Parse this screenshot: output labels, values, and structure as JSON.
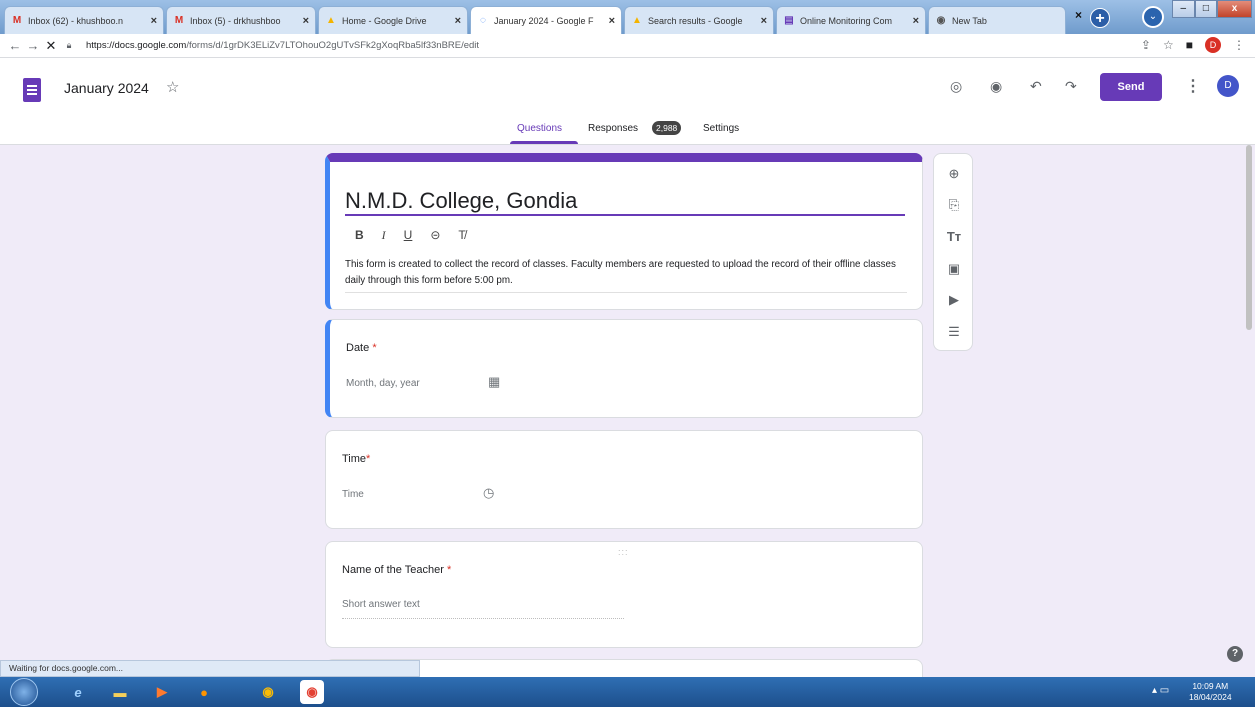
{
  "browser": {
    "tabs": [
      {
        "label": "Inbox (62) - khushboo.n",
        "icon": "gmail-icon",
        "active": false
      },
      {
        "label": "Inbox (5) - drkhushboo",
        "icon": "gmail-icon",
        "active": false
      },
      {
        "label": "Home - Google Drive",
        "icon": "drive-icon",
        "active": false
      },
      {
        "label": "January 2024 - Google F",
        "icon": "loading-icon",
        "active": true
      },
      {
        "label": "Search results - Google",
        "icon": "drive-icon",
        "active": false
      },
      {
        "label": "Online Monitoring Com",
        "icon": "forms-icon",
        "active": false
      },
      {
        "label": "New Tab",
        "icon": "chrome-icon",
        "active": false
      }
    ],
    "url_host": "https://docs.google.com",
    "url_path": "/forms/d/1grDK3ELiZv7LTOhouO2gUTvSFk2gXoqRba5lf33nBRE/edit",
    "close_label": "×",
    "profile_letter": "D"
  },
  "form_header": {
    "title": "January 2024",
    "send_label": "Send",
    "avatar_letter": "D",
    "tabs": {
      "questions": "Questions",
      "responses": "Responses",
      "responses_count": "2,988",
      "settings": "Settings"
    }
  },
  "form": {
    "title": "N.M.D. College, Gondia",
    "format_buttons": [
      "B",
      "I",
      "U",
      "⊝",
      "T̸"
    ],
    "description": "This form is created to collect the record of classes. Faculty members are requested to upload the record of their offline classes daily through this form before 5:00 pm.",
    "questions": [
      {
        "label": "Date",
        "required": "*",
        "hint": "Month, day, year",
        "icon": "calendar-icon"
      },
      {
        "label": "Time",
        "required": "*",
        "hint": "Time",
        "icon": "clock-icon"
      },
      {
        "label": "Name of the Teacher",
        "required": "*",
        "hint": "Short answer text",
        "drag": ":::"
      }
    ]
  },
  "side_toolbar": [
    "add-question-icon",
    "import-questions-icon",
    "add-title-icon",
    "add-image-icon",
    "add-video-icon",
    "add-section-icon"
  ],
  "status_text": "Waiting for docs.google.com...",
  "taskbar": {
    "time": "10:09 AM",
    "date": "18/04/2024"
  }
}
